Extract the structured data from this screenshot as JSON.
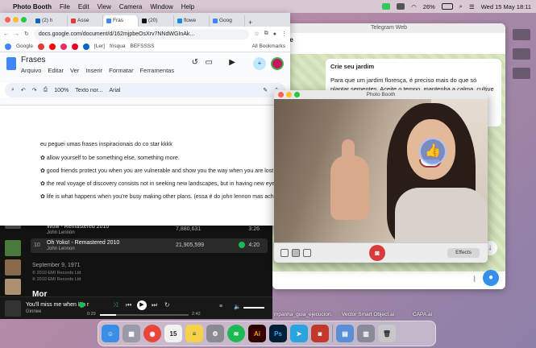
{
  "menubar": {
    "apple": "",
    "app_name": "Photo Booth",
    "items": [
      "File",
      "Edit",
      "View",
      "Camera",
      "Window",
      "Help"
    ],
    "battery": "26%",
    "datetime": "Wed 15 May  18:11"
  },
  "telegram": {
    "window_title": "Telegram Web",
    "contact_name": "jeixe",
    "contact_status": "line",
    "message_title": "Crie seu jardim",
    "message_body": "Para que um jardim floresça, é preciso mais do que só plantar sementes. Aceite o tempo, mantenha a calma, cultive o amor e"
  },
  "chrome": {
    "tabs": [
      {
        "label": "(2) h",
        "color": "#0a66c2"
      },
      {
        "label": "Asse",
        "color": "#e53935"
      },
      {
        "label": "Fras",
        "color": "#4285f4"
      },
      {
        "label": "(20)",
        "color": "#111111"
      },
      {
        "label": "flowe",
        "color": "#1e88e5"
      },
      {
        "label": "Goog",
        "color": "#4285f4"
      }
    ],
    "url": "docs.google.com/document/d/162mjpbeOsXrv7NNdWGInAk...",
    "bookmarks_left": "Google",
    "bookmarks_items": [
      "[Ler]",
      "frisqua",
      "BEFSSSS"
    ],
    "all_bookmarks": "All Bookmarks"
  },
  "docs": {
    "title": "Frases",
    "menu": [
      "Arquivo",
      "Editar",
      "Ver",
      "Inserir",
      "Formatar",
      "Ferramentas"
    ],
    "zoom": "100%",
    "style": "Texto nor...",
    "font": "Arial",
    "lines": [
      "eu peguei umas frases inspiracionais do co star kkkk",
      "✿ allow yourself to be something else, something more.",
      "✿ good friends protect you when you are vulnerable and show you the way when you are lost",
      "✿ the real voyage of discovery consists not in seeking new landscapes, but in having new eyes.",
      "✿ life is what happens when you're busy making other plans. (essa é do john lennon mas acho linda)"
    ]
  },
  "spotify": {
    "rows": [
      {
        "num": "",
        "title": "Wow - Remastered 2010",
        "artist": "John Lennon",
        "plays": "7,880,631",
        "duration": "3:26"
      },
      {
        "num": "10",
        "title": "Oh Yoko! - Remastered 2010",
        "artist": "John Lennon",
        "plays": "21,905,599",
        "duration": "4:20"
      }
    ],
    "album_date": "September 9, 1971",
    "copyright_1": "© 2010 EMI Records Ltd",
    "copyright_2": "℗ 2010 EMI Records Ltd",
    "more_heading": "Mor",
    "now_playing_title": "You'll miss me when I'm r",
    "now_playing_artist": "Ginnee",
    "time_elapsed": "0:29",
    "time_total": "2:42",
    "progress": 0.18
  },
  "photobooth": {
    "window_title": "Photo Booth",
    "effects_label": "Effects",
    "reaction": "👍"
  },
  "desktop_files": [
    "mpanha_guia_ejecucion.",
    "Vector Smart Object.ai",
    "CAPA.ai"
  ],
  "dock": [
    {
      "name": "Finder",
      "glyph": "☺",
      "color": "#3b8ee8"
    },
    {
      "name": "Launchpad",
      "glyph": "▦",
      "color": "#9a9aa8"
    },
    {
      "name": "Chrome",
      "glyph": "◉",
      "color": "#e8453c"
    },
    {
      "name": "Calendar",
      "glyph": "15",
      "color": "#f2f2f2"
    },
    {
      "name": "Notes",
      "glyph": "≡",
      "color": "#f5d14a"
    },
    {
      "name": "System Settings",
      "glyph": "⚙",
      "color": "#8a8a92"
    },
    {
      "name": "Spotify",
      "glyph": "≋",
      "color": "#1db954"
    },
    {
      "name": "Illustrator",
      "glyph": "Ai",
      "color": "#330000"
    },
    {
      "name": "Photoshop",
      "glyph": "Ps",
      "color": "#001e36"
    },
    {
      "name": "Telegram",
      "glyph": "➤",
      "color": "#2aa3df"
    },
    {
      "name": "Photo Booth",
      "glyph": "◙",
      "color": "#c0392b"
    },
    {
      "name": "Downloads",
      "glyph": "▤",
      "color": "#5a8fd8"
    },
    {
      "name": "Recent",
      "glyph": "▥",
      "color": "#8a8a9a"
    },
    {
      "name": "Trash",
      "glyph": "🗑",
      "color": "#c8c8cc"
    }
  ]
}
